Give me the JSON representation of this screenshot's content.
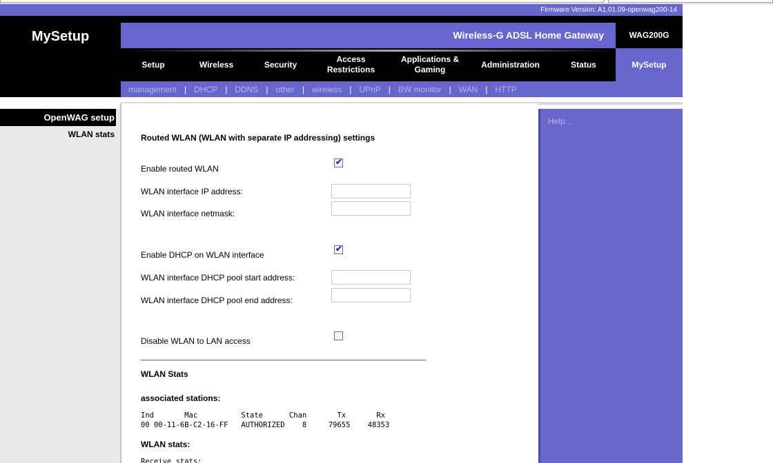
{
  "header": {
    "firmware_label": "Firmware Version: A1.01.09-openwag200-14",
    "brand_title": "MySetup",
    "product_name": "Wireless-G ADSL Home Gateway",
    "model": "WAG200G"
  },
  "nav": {
    "items": [
      {
        "label": "Setup"
      },
      {
        "label": "Wireless"
      },
      {
        "label": "Security"
      },
      {
        "label": "Access\nRestrictions"
      },
      {
        "label": "Applications &\nGaming"
      },
      {
        "label": "Administration"
      },
      {
        "label": "Status"
      }
    ],
    "active": "MySetup"
  },
  "subnav": {
    "items": [
      "management",
      "DHCP",
      "DDNS",
      "other",
      "wireless",
      "UPnP",
      "BW monitor",
      "WAN",
      "HTTP"
    ],
    "separator": "|"
  },
  "sidebar": {
    "title": "OpenWAG setup",
    "link": "WLAN stats"
  },
  "form": {
    "title": "Routed WLAN (WLAN with separate IP addressing) settings",
    "enable_routed_label": "Enable routed WLAN",
    "enable_routed_checked": true,
    "ip_label": "WLAN interface IP address:",
    "ip_value": "",
    "netmask_label": "WLAN interface netmask:",
    "netmask_value": "",
    "enable_dhcp_label": "Enable DHCP on WLAN interface",
    "enable_dhcp_checked": true,
    "pool_start_label": "WLAN interface DHCP pool start address:",
    "pool_start_value": "",
    "pool_end_label": "WLAN interface DHCP pool end address:",
    "pool_end_value": "",
    "disable_wlan_lan_label": "Disable WLAN to LAN access",
    "disable_wlan_lan_checked": false
  },
  "stats": {
    "title": "WLAN Stats",
    "assoc_title": "associated stations:",
    "assoc_header": "Ind       Mac          State      Chan       Tx       Rx",
    "assoc_row": "00 00-11-6B-C2-16-FF   AUTHORIZED    8     79655    48353",
    "wlan_stats_title": "WLAN stats:",
    "receive_label": "Receive stats:"
  },
  "help": {
    "label": "Help..."
  },
  "colors": {
    "brand_purple": "#6666cc",
    "subnav_link": "#b8b8ec",
    "black": "#000000"
  }
}
